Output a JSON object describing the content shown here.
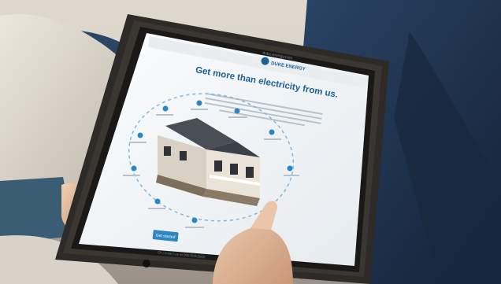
{
  "photo": {
    "brand_logo_text": "DUKE ENERGY",
    "headline": "Get more than electricity from us.",
    "url_bar_text": "duke-energy.com",
    "cta_button_label": "Get started",
    "contact_line": "Or contact us at 000.000.0000"
  },
  "colors": {
    "background_top": "#c9c2b6",
    "background_bottom": "#a79f94",
    "jeans": "#1f3452",
    "sweater": "#d7d1c7",
    "sleeve": "#3b5d73",
    "tablet_case": "#2d2a27",
    "screen_white": "#f6f7f8",
    "brand_blue": "#1c5f97",
    "button_blue": "#2d86c4",
    "ring_blue": "#80b8dd",
    "skin": "#e3ba9c"
  }
}
